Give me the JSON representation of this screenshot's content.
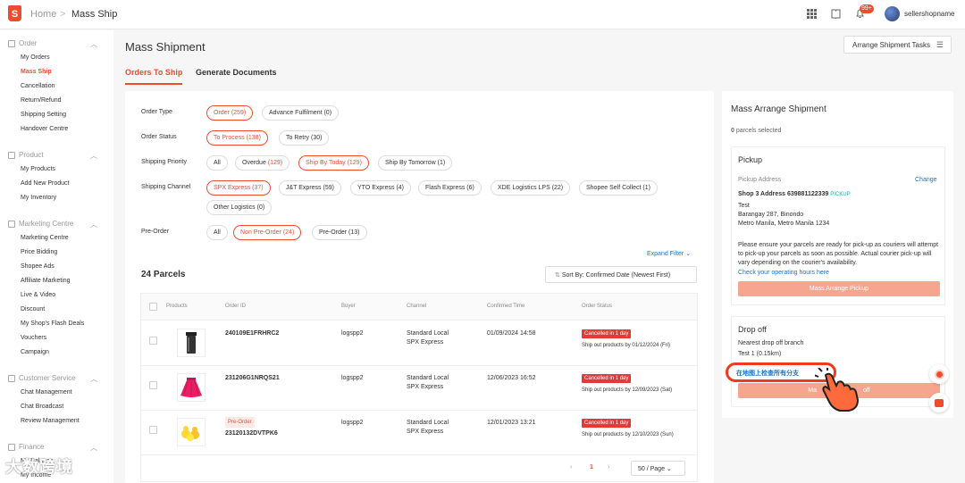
{
  "topbar": {
    "logo_letter": "S",
    "home": "Home",
    "sep": ">",
    "page": "Mass Ship",
    "badge": "99+",
    "shop_name": "sellershopname"
  },
  "sidebar": {
    "order": {
      "title": "Order",
      "items": [
        "My Orders",
        "Mass Ship",
        "Cancellation",
        "Return/Refund",
        "Shipping Setting",
        "Handover Centre"
      ]
    },
    "product": {
      "title": "Product",
      "items": [
        "My Products",
        "Add New Product",
        "My Inventory"
      ]
    },
    "marketing": {
      "title": "Marketing Centre",
      "items": [
        "Marketing Centre",
        "Price Bidding",
        "Shopee Ads",
        "Affiliate Marketing",
        "Live & Video",
        "Discount",
        "My Shop's Flash Deals",
        "Vouchers",
        "Campaign"
      ]
    },
    "customer": {
      "title": "Customer Service",
      "items": [
        "Chat Management",
        "Chat Broadcast",
        "Review Management"
      ]
    },
    "finance": {
      "title": "Finance",
      "items": [
        "My Balance",
        "My Income"
      ]
    }
  },
  "header": {
    "title": "Mass Shipment",
    "tabs": [
      "Orders To Ship",
      "Generate Documents"
    ],
    "arrange_tasks": "Arrange Shipment Tasks"
  },
  "filters": {
    "order_type": {
      "label": "Order Type",
      "chips": [
        "Order (259)",
        "Advance Fulfilment (0)"
      ]
    },
    "order_status": {
      "label": "Order Status",
      "chips": [
        "To Process (138)",
        "To Retry (30)"
      ]
    },
    "shipping_priority": {
      "label": "Shipping Priority",
      "all": "All",
      "overdue": "Overdue ",
      "overdue_count": "(129)",
      "today": "Ship By Today (129)",
      "tomorrow": "Ship By Tomorrow (1)"
    },
    "shipping_channel": {
      "label": "Shipping Channel",
      "chips": [
        "SPX Express (37)",
        "J&T Express (59)",
        "YTO Express (4)",
        "Flash Express (6)",
        "XDE Logistics LPS (22)",
        "Shopee Self Collect (1)",
        "Other Logistics (0)"
      ]
    },
    "pre_order": {
      "label": "Pre-Order",
      "chips": [
        "All",
        "Non Pre-Order (24)",
        "Pre-Order (13)"
      ]
    },
    "expand": "Expand Filter"
  },
  "list": {
    "parcels": "24 Parcels",
    "sort": "Sort By: Confirmed Date (Newest First)",
    "columns": [
      "Products",
      "Order ID",
      "Buyer",
      "Channel",
      "Confirmed Time",
      "Order Status"
    ],
    "rows": [
      {
        "order_id": "240109E1FRHRC2",
        "buyer": "logspp2",
        "channel1": "Standard Local",
        "channel2": "SPX Express",
        "time": "01/09/2024 14:58",
        "status": "Cancelled in 1 day",
        "ship": "Ship out products by 01/12/2024 (Fri)",
        "pre": ""
      },
      {
        "order_id": "231206G1NRQS21",
        "buyer": "logspp2",
        "channel1": "Standard Local",
        "channel2": "SPX Express",
        "time": "12/06/2023 16:52",
        "status": "Cancelled in 1 day",
        "ship": "Ship out products by 12/09/2023 (Sat)",
        "pre": ""
      },
      {
        "order_id": "23120132DVTPK6",
        "buyer": "logspp2",
        "channel1": "Standard Local",
        "channel2": "SPX Express",
        "time": "12/01/2023 13:21",
        "status": "Cancelled in 1 day",
        "ship": "Ship out products by 12/10/2023 (Sun)",
        "pre": "Pre-Order"
      }
    ],
    "page": "1",
    "per_page": "50 / Page"
  },
  "right": {
    "title": "Mass Arrange Shipment",
    "selected_count": "0",
    "selected_text": " parcels selected",
    "pickup": {
      "title": "Pickup",
      "address_label": "Pickup Address",
      "change": "Change",
      "shop": "Shop 3 Address 639881122339",
      "tag": "PICKUP",
      "line1": "Test",
      "line2": "Barangay 287, Binondo",
      "line3": "Metro Manila, Metro Manila 1234",
      "note": "Please ensure your parcels are ready for pick-up as couriers will attempt to pick-up your parcels as soon as possible. Actual courier pick-up will vary depending on the courier's availability.",
      "hours": "Check your operating hours here",
      "button": "Mass Arrange Pickup"
    },
    "dropoff": {
      "title": "Drop off",
      "nearest": "Nearest drop off branch",
      "branch": "Test 1 (0.15km)",
      "map_link": "在地图上检查所有分支",
      "button_left": "Ma",
      "button_right": "off"
    }
  },
  "watermark": "大数跨境"
}
